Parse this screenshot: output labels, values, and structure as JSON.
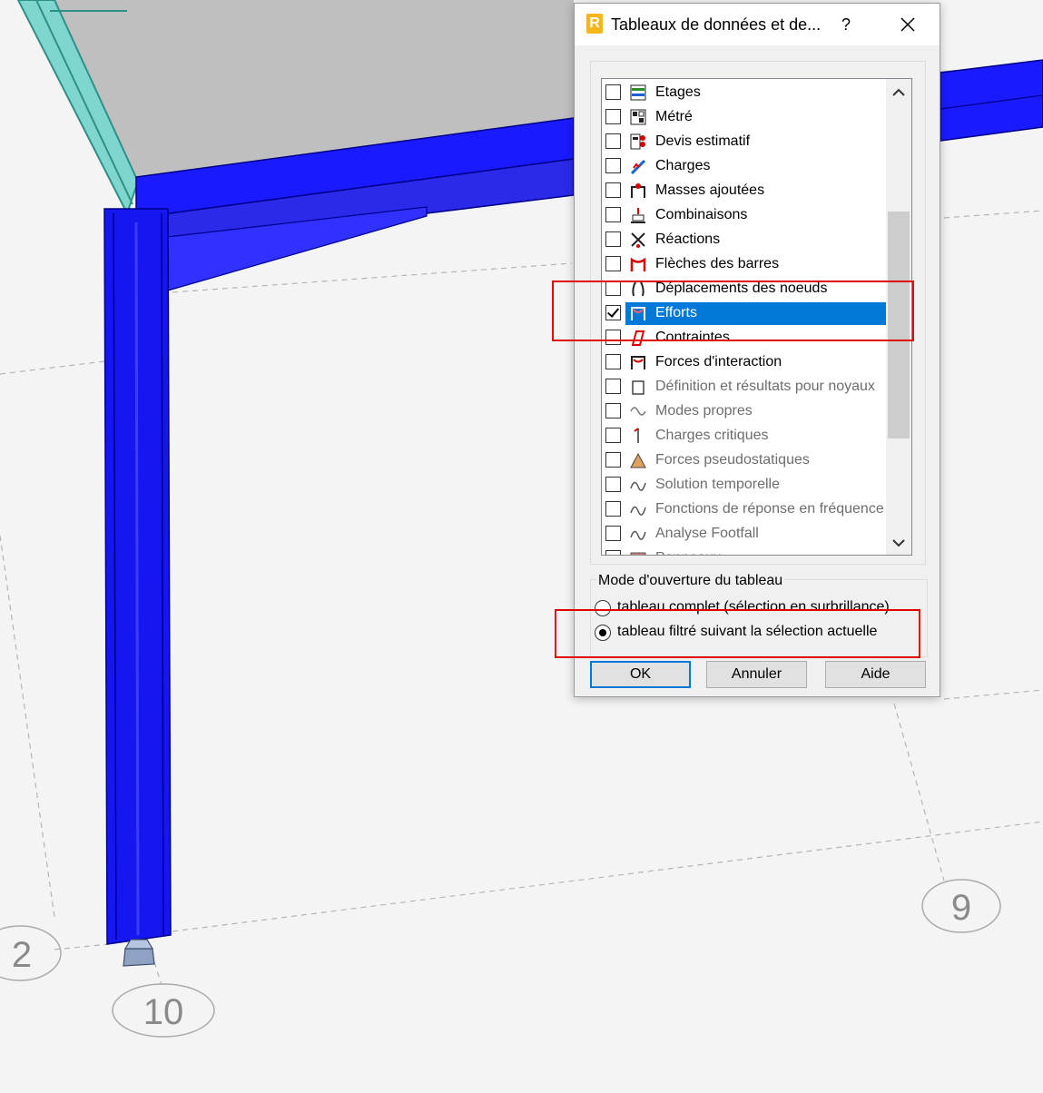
{
  "dialog": {
    "title": "Tableaux de données et de...",
    "help_label": "?",
    "list_items": [
      {
        "label": "Etages",
        "checked": false,
        "enabled": true,
        "icon": "floors-icon"
      },
      {
        "label": "Métré",
        "checked": false,
        "enabled": true,
        "icon": "takeoff-icon"
      },
      {
        "label": "Devis estimatif",
        "checked": false,
        "enabled": true,
        "icon": "estimate-icon"
      },
      {
        "label": "Charges",
        "checked": false,
        "enabled": true,
        "icon": "loads-icon"
      },
      {
        "label": "Masses ajoutées",
        "checked": false,
        "enabled": true,
        "icon": "added-masses-icon"
      },
      {
        "label": "Combinaisons",
        "checked": false,
        "enabled": true,
        "icon": "combinations-icon"
      },
      {
        "label": "Réactions",
        "checked": false,
        "enabled": true,
        "icon": "reactions-icon"
      },
      {
        "label": "Flèches des barres",
        "checked": false,
        "enabled": true,
        "icon": "bar-deflection-icon"
      },
      {
        "label": "Déplacements des noeuds",
        "checked": false,
        "enabled": true,
        "icon": "node-displacement-icon"
      },
      {
        "label": "Efforts",
        "checked": true,
        "enabled": true,
        "selected": true,
        "icon": "forces-icon"
      },
      {
        "label": "Contraintes",
        "checked": false,
        "enabled": true,
        "icon": "stresses-icon"
      },
      {
        "label": "Forces d'interaction",
        "checked": false,
        "enabled": true,
        "icon": "interaction-forces-icon"
      },
      {
        "label": "Définition et résultats pour noyaux",
        "checked": false,
        "enabled": false,
        "icon": "cores-icon"
      },
      {
        "label": "Modes propres",
        "checked": false,
        "enabled": false,
        "icon": "eigenmodes-icon"
      },
      {
        "label": "Charges critiques",
        "checked": false,
        "enabled": false,
        "icon": "critical-loads-icon"
      },
      {
        "label": "Forces pseudostatiques",
        "checked": false,
        "enabled": false,
        "icon": "pseudostatic-forces-icon"
      },
      {
        "label": "Solution temporelle",
        "checked": false,
        "enabled": false,
        "icon": "time-history-icon"
      },
      {
        "label": "Fonctions de réponse en fréquence (",
        "checked": false,
        "enabled": false,
        "icon": "frequency-response-icon"
      },
      {
        "label": "Analyse Footfall",
        "checked": false,
        "enabled": false,
        "icon": "footfall-icon"
      },
      {
        "label": "Panneaux",
        "checked": false,
        "enabled": false,
        "icon": "panels-icon"
      }
    ],
    "mode_group_label": "Mode d'ouverture du tableau",
    "radio_options": [
      {
        "label": "tableau complet (sélection en surbrillance)",
        "selected": false
      },
      {
        "label": "tableau filtré suivant la sélection actuelle",
        "selected": true
      }
    ],
    "buttons": {
      "ok": "OK",
      "cancel": "Annuler",
      "help": "Aide"
    }
  },
  "grid_labels": [
    "9",
    "2",
    "10"
  ],
  "colors": {
    "selection": "#0078d7",
    "highlight_box": "#e00000",
    "steel_member": "#1a1aff",
    "slab": "#bdbdbd",
    "glass_frame": "#5fc9c4"
  }
}
